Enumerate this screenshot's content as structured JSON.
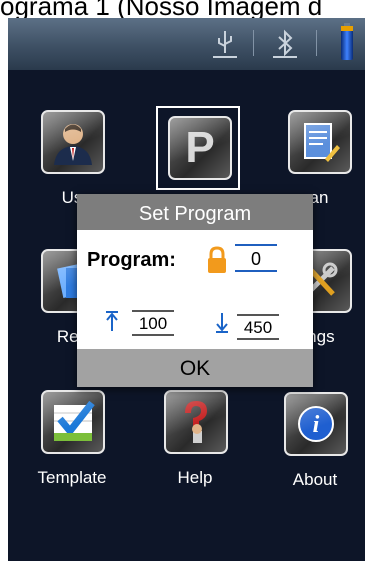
{
  "caption": "ograma 1 (Nosso Imagem d",
  "status_bar": {
    "icons": [
      "usb-icon",
      "bluetooth-icon",
      "battery-icon"
    ]
  },
  "apps": [
    {
      "label": "Us",
      "icon": "user-icon"
    },
    {
      "label": "",
      "icon": "program-p-icon"
    },
    {
      "label": "an",
      "icon": "plan-notepad-icon"
    },
    {
      "label": "Res",
      "icon": "results-icon"
    },
    {
      "label": "ings",
      "icon": "settings-icon"
    },
    {
      "label": "Template",
      "icon": "template-icon"
    },
    {
      "label": "Help",
      "icon": "help-icon"
    },
    {
      "label": "About",
      "icon": "about-icon"
    }
  ],
  "dialog": {
    "title": "Set Program",
    "program_label": "Program:",
    "program_value": "0",
    "lower_value": "100",
    "upper_value": "450",
    "ok_label": "OK"
  },
  "colors": {
    "screen_bg": "#0d1528",
    "dialog_header": "#7d7d7d",
    "ok_bar": "#a2a2a2",
    "accent_blue": "#1a64c8",
    "lock_orange": "#f29a1c"
  }
}
